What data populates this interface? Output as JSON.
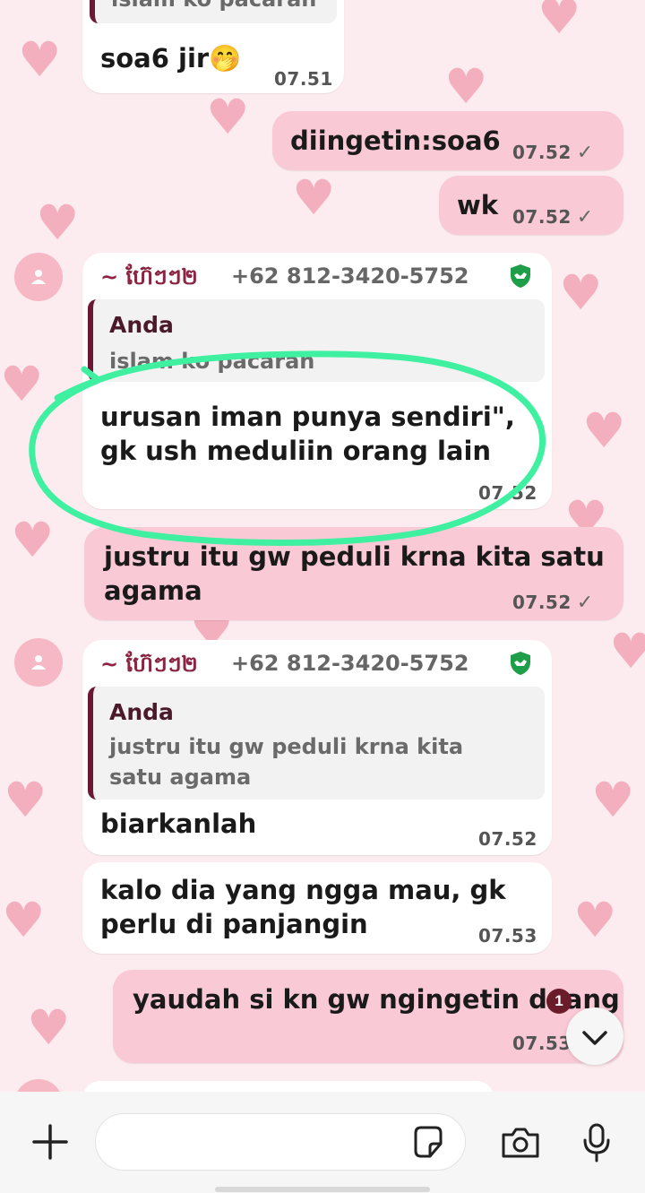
{
  "chat": {
    "messages": [
      {
        "id": "m1",
        "direction": "in",
        "quote_partial": "islam ko pacaran",
        "text": "soa6 jir",
        "emoji": "🤭",
        "time": "07.51"
      },
      {
        "id": "m2",
        "direction": "out",
        "text": "diingetin:soa6",
        "time": "07.52"
      },
      {
        "id": "m3",
        "direction": "out",
        "text": "wk",
        "time": "07.52"
      },
      {
        "id": "m4",
        "direction": "in",
        "sender_name": "~ ហ៊ែៗៗ២",
        "sender_phone": "+62 812-3420-5752",
        "quote_author": "Anda",
        "quote_text": "islam ko pacaran",
        "text_line1": "urusan iman punya sendiri\",",
        "text_line2": "gk ush meduliin orang lain",
        "time": "07.52"
      },
      {
        "id": "m5",
        "direction": "out",
        "text_line1": "justru itu gw peduli krna kita satu",
        "text_line2": "agama",
        "time": "07.52"
      },
      {
        "id": "m6",
        "direction": "in",
        "sender_name": "~ ហ៊ែៗៗ២",
        "sender_phone": "+62 812-3420-5752",
        "quote_author": "Anda",
        "quote_text_line1": "justru itu gw peduli krna kita",
        "quote_text_line2": "satu agama",
        "text": "biarkanlah",
        "time": "07.52"
      },
      {
        "id": "m7",
        "direction": "in",
        "text_line1": "kalo dia yang ngga mau, gk",
        "text_line2": "perlu di panjangin",
        "time": "07.53"
      },
      {
        "id": "m8",
        "direction": "out",
        "text": "yaudah si kn gw ngingetin doang",
        "time": "07.53"
      }
    ],
    "read_mark": "✓",
    "unread_count": "1"
  },
  "composer": {
    "placeholder": ""
  },
  "icons": {
    "attach": "plus-icon",
    "sticker": "sticker-icon",
    "camera": "camera-icon",
    "mic": "microphone-icon",
    "scroll": "chevron-down-icon",
    "shield": "shield-icon",
    "avatar": "person-icon"
  },
  "colors": {
    "incoming": "#ffffff",
    "outgoing": "#f9c9d6",
    "annotation": "#3ef0a0",
    "shield": "#1f9e4a",
    "quote_bar": "#6b1834"
  }
}
